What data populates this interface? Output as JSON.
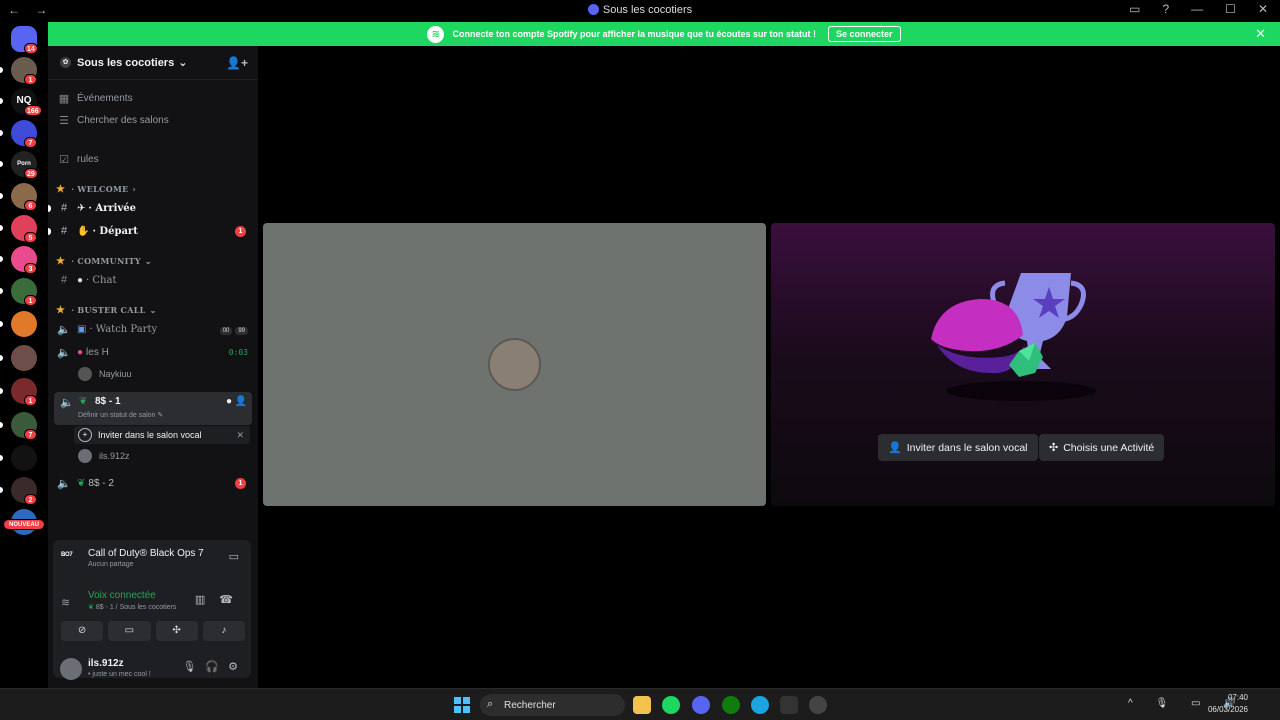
{
  "window": {
    "title": "Sous les cocotiers",
    "nav": "← →"
  },
  "titlebar_icons": [
    "inbox-icon",
    "help-icon",
    "minimize-icon",
    "maximize-icon",
    "close-icon"
  ],
  "servers": [
    {
      "name": "direct-messages",
      "badge": "14",
      "color": "#5865f2"
    },
    {
      "name": "server-1",
      "badge": "1",
      "color": "#6a5b4f"
    },
    {
      "name": "server-nq",
      "badge": "166",
      "color": "#111",
      "label": "NQ"
    },
    {
      "name": "server-star",
      "badge": "7",
      "color": "#3f4bd8"
    },
    {
      "name": "server-porn",
      "badge": "29",
      "color": "#222",
      "label": "Porn"
    },
    {
      "name": "server-6",
      "badge": "6",
      "color": "#8b6a4a"
    },
    {
      "name": "server-discord-red",
      "badge": "5",
      "color": "#e0405a"
    },
    {
      "name": "server-discord-pink",
      "badge": "3",
      "color": "#e94b8c"
    },
    {
      "name": "server-9",
      "badge": "1",
      "color": "#3b6b3b"
    },
    {
      "name": "server-10",
      "badge": "",
      "color": "#e07a2a"
    },
    {
      "name": "server-11",
      "badge": "",
      "color": "#6e4e4a"
    },
    {
      "name": "server-12",
      "badge": "1",
      "color": "#7a2a2a"
    },
    {
      "name": "server-13",
      "badge": "7",
      "color": "#3a5a3a"
    },
    {
      "name": "server-14",
      "badge": "",
      "color": "#121212"
    },
    {
      "name": "server-15",
      "badge": "2",
      "color": "#3a2a2a"
    },
    {
      "name": "server-new",
      "badge": "",
      "color": "#2b6bbd"
    }
  ],
  "new_label": "NOUVEAU",
  "banner": {
    "text": "Connecte ton compte Spotify pour afficher la musique que tu écoutes sur ton statut !",
    "button": "Se connecter"
  },
  "server_header": {
    "name": "Sous les cocotiers"
  },
  "channels": {
    "events": "Événements",
    "browse": "Chercher des salons",
    "rules": "rules",
    "cat_welcome": "· WELCOME",
    "arrivee": "· Arrivée",
    "depart": "· Départ",
    "depart_badge": "1",
    "cat_community": "· COMMUNITY",
    "chat": "· Chat",
    "cat_buster": "· BUSTER CALL",
    "watch_party": "· Watch Party",
    "watch_tag1": "00",
    "watch_tag2": "99",
    "les_h": "les H",
    "les_h_time": "0:03",
    "les_h_user": "Naykiuu",
    "voice_81": "8$ - 1",
    "voice_81_status": "Définir un statut de salon",
    "invite_voice": "Inviter dans le salon vocal",
    "voice_81_user": "ils.912z",
    "voice_82": "8$ - 2",
    "voice_82_badge": "1"
  },
  "activity": {
    "game_logo": "BO7",
    "game": "Call of Duty® Black Ops 7",
    "game_sub": "Aucun partage",
    "voice_title": "Voix connectée",
    "voice_sub": "8$ - 1 / Sous les cocotiers"
  },
  "user": {
    "name": "ils.912z",
    "status": "• juste un mec cool !"
  },
  "stage": {
    "invite": "Inviter dans le salon vocal",
    "activity": "Choisis une Activité"
  },
  "taskbar": {
    "search": "Rechercher",
    "time": "07:40",
    "date": "06/03/2026"
  }
}
